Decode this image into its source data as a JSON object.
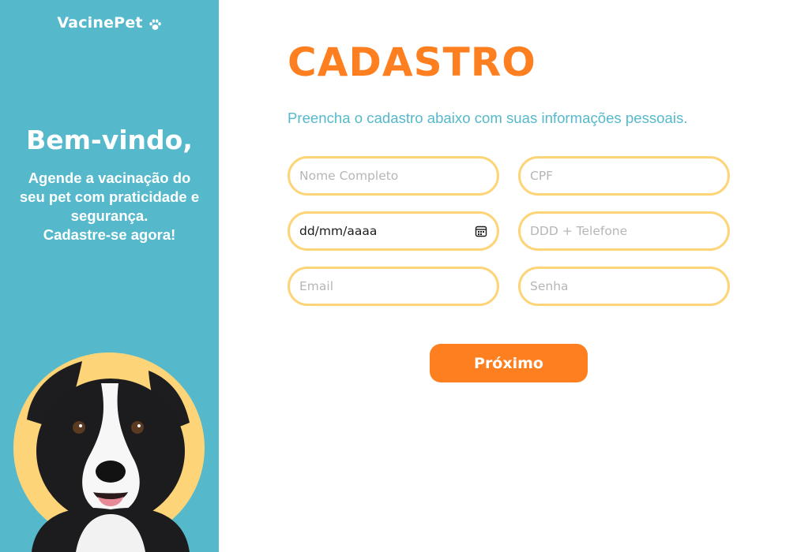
{
  "sidebar": {
    "brand": "VacinePet",
    "welcome": "Bem-vindo,",
    "tagline_lines": [
      "Agende a vacinação do",
      "seu pet com praticidade e",
      "segurança.",
      "Cadastre-se agora!"
    ]
  },
  "main": {
    "title": "CADASTRO",
    "subtitle": "Preencha o cadastro abaixo com suas informações pessoais.",
    "fields": {
      "name_placeholder": "Nome Completo",
      "cpf_placeholder": "CPF",
      "birthdate_value": "dd/mm/aaaa",
      "phone_placeholder": "DDD + Telefone",
      "email_placeholder": "Email",
      "password_placeholder": "Senha"
    },
    "next_label": "Próximo"
  },
  "colors": {
    "sidebar_bg": "#55b9cb",
    "accent_orange": "#fd7f20",
    "input_border": "#fdd578",
    "circle_yellow": "#fdd578"
  },
  "icons": [
    "paw-icon",
    "calendar-icon"
  ]
}
